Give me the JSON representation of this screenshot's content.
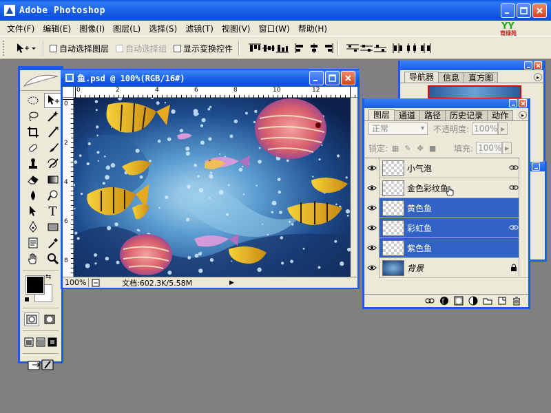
{
  "app": {
    "title": "Adobe Photoshop"
  },
  "menu": [
    "文件(F)",
    "编辑(E)",
    "图像(I)",
    "图层(L)",
    "选择(S)",
    "滤镜(T)",
    "视图(V)",
    "窗口(W)",
    "帮助(H)"
  ],
  "logo": {
    "text": "育绿苑"
  },
  "options": {
    "auto_select_layer": "自动选择图层",
    "auto_select_group": "自动选择组",
    "show_transform": "显示变换控件"
  },
  "document": {
    "title": "鱼.psd @ 100%(RGB/16#)",
    "zoom": "100%",
    "status": "文档:602.3K/5.58M",
    "ruler_h": [
      "0",
      "2",
      "4",
      "6",
      "8",
      "10",
      "12"
    ],
    "ruler_v": [
      "0",
      "2",
      "4",
      "6",
      "8"
    ]
  },
  "navigator": {
    "tabs": [
      "导航器",
      "信息",
      "直方图"
    ]
  },
  "layers_panel": {
    "tabs": [
      "图层",
      "通道",
      "路径",
      "历史记录",
      "动作"
    ],
    "blend_mode": "正常",
    "opacity_label": "不透明度:",
    "opacity_value": "100%",
    "lock_label": "锁定:",
    "fill_label": "填充:",
    "fill_value": "100%",
    "layers": [
      {
        "name": "小气泡",
        "selected": false,
        "linked": true,
        "locked": false,
        "type": "transparent"
      },
      {
        "name": "金色彩纹鱼",
        "selected": false,
        "linked": true,
        "locked": false,
        "type": "transparent"
      },
      {
        "name": "黄色鱼",
        "selected": true,
        "linked": false,
        "locked": false,
        "type": "transparent"
      },
      {
        "name": "彩虹鱼",
        "selected": true,
        "linked": true,
        "locked": false,
        "type": "transparent"
      },
      {
        "name": "紫色鱼",
        "selected": true,
        "linked": false,
        "locked": false,
        "type": "transparent"
      },
      {
        "name": "背景",
        "selected": false,
        "linked": false,
        "locked": true,
        "type": "background"
      }
    ]
  },
  "colors": {
    "xp_blue": "#1e5ae6",
    "panel_bg": "#ece9d8",
    "selection": "#3163c6",
    "foreground": "#000000",
    "background": "#ffffff"
  }
}
